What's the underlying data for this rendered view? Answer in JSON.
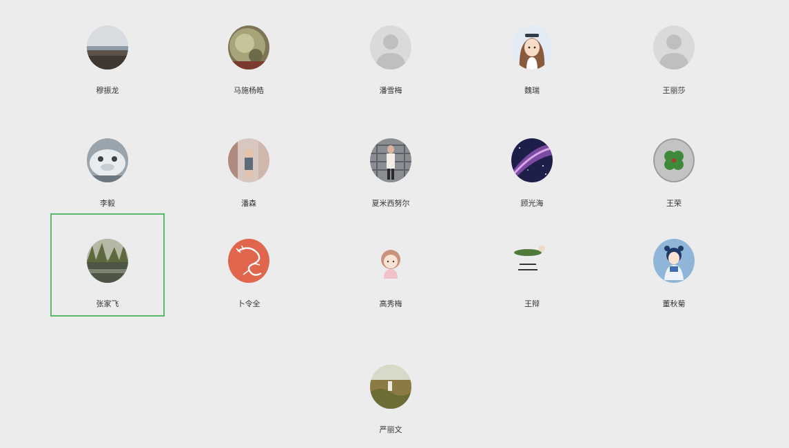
{
  "members": [
    {
      "name": "穆振龙",
      "avatar": "seaside-photo-avatar"
    },
    {
      "name": "马施杨皓",
      "avatar": "green-stone-photo-avatar"
    },
    {
      "name": "潘雪梅",
      "avatar": "default-person-avatar"
    },
    {
      "name": "魏瑞",
      "avatar": "cartoon-girl-avatar"
    },
    {
      "name": "王丽莎",
      "avatar": "default-person-avatar"
    },
    {
      "name": "李毅",
      "avatar": "snow-sculpture-photo-avatar"
    },
    {
      "name": "潘森",
      "avatar": "child-photo-avatar"
    },
    {
      "name": "夏米西努尔",
      "avatar": "person-by-wall-photo-avatar"
    },
    {
      "name": "顾光海",
      "avatar": "galaxy-photo-avatar"
    },
    {
      "name": "王荣",
      "avatar": "four-leaf-clover-avatar"
    },
    {
      "name": "张家飞",
      "avatar": "forest-pond-photo-avatar",
      "selected": true
    },
    {
      "name": "卜令全",
      "avatar": "orange-dragon-avatar"
    },
    {
      "name": "高秀梅",
      "avatar": "cartoon-girl-pink-avatar"
    },
    {
      "name": "王辩",
      "avatar": "pickle-calligraphy-avatar"
    },
    {
      "name": "董秋菊",
      "avatar": "anime-girl-blue-avatar"
    },
    {
      "name": "严丽文",
      "avatar": "field-photo-avatar"
    }
  ]
}
